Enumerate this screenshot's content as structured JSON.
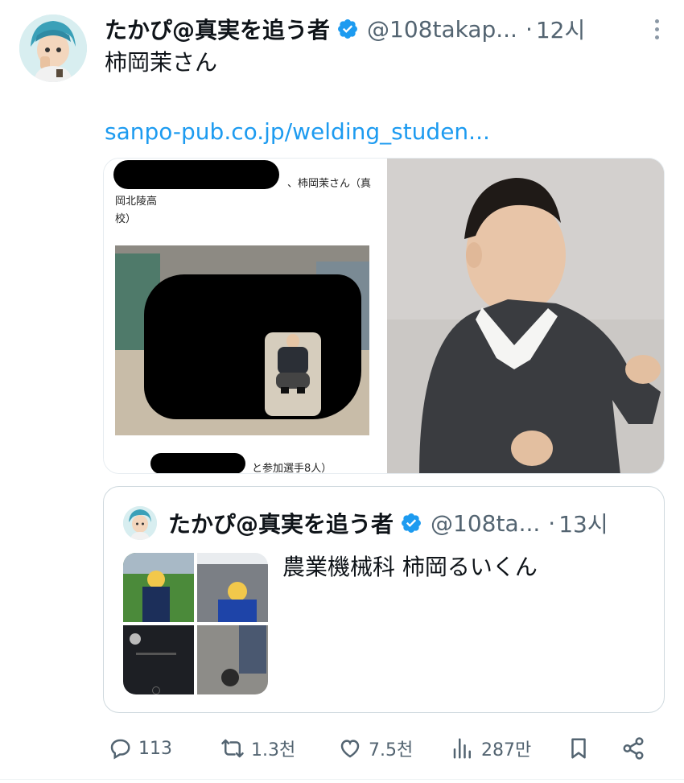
{
  "tweet": {
    "display_name": "たかぴ@真実を追う者",
    "handle": "@108takap...",
    "separator": "·",
    "time": "12시",
    "text": "柿岡茉さん",
    "link": "sanpo-pub.co.jp/welding_studen...",
    "media_left": {
      "line1": "、柿岡茉さん（真",
      "line2": "岡北陵高",
      "line3": "校）",
      "caption": "と参加選手8人）"
    }
  },
  "quote": {
    "display_name": "たかぴ@真実を追う者",
    "handle": "@108ta...",
    "separator": "·",
    "time": "13시",
    "text": "農業機械科 柿岡るいくん"
  },
  "actions": {
    "replies": "113",
    "retweets": "1.3천",
    "likes": "7.5천",
    "views": "287만"
  },
  "colors": {
    "accent": "#1d9bf0",
    "secondary_text": "#536471",
    "border": "#cfd9de"
  },
  "icons": [
    "verified-badge-icon",
    "more-options-icon",
    "reply-icon",
    "retweet-icon",
    "like-icon",
    "views-icon",
    "bookmark-icon",
    "share-icon"
  ]
}
